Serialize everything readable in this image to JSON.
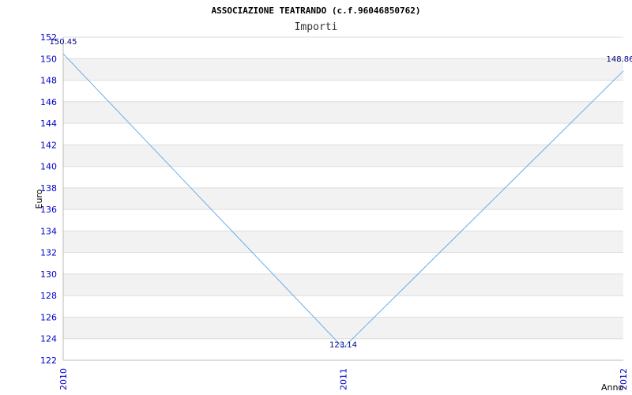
{
  "chart_data": {
    "type": "line",
    "title": "ASSOCIAZIONE TEATRANDO (c.f.96046850762)",
    "subtitle": "Importi",
    "xlabel": "Anno",
    "ylabel": "Euro",
    "categories": [
      "2010",
      "2011",
      "2012"
    ],
    "values": [
      150.45,
      123.14,
      148.86
    ],
    "data_labels": [
      "150.45",
      "123.14",
      "148.86"
    ],
    "yticks": [
      "122",
      "124",
      "126",
      "128",
      "130",
      "132",
      "134",
      "136",
      "138",
      "140",
      "142",
      "144",
      "146",
      "148",
      "150",
      "152"
    ],
    "ylim": [
      122,
      152
    ],
    "grid": "horizontal alternating bands",
    "colors": {
      "line": "#6aaee8",
      "tick_text": "#0000cc",
      "data_label": "#000080",
      "band": "#f2f2f2",
      "gridline": "#dddddd",
      "axis": "#bbbbbb"
    }
  }
}
